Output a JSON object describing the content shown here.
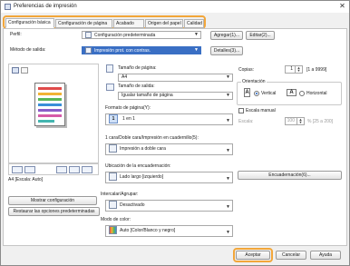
{
  "window": {
    "title": "Preferencias de impresión",
    "close_glyph": "✕"
  },
  "tabs": [
    {
      "label": "Configuración básica",
      "active": true
    },
    {
      "label": "Configuración de página",
      "active": false
    },
    {
      "label": "Acabado",
      "active": false
    },
    {
      "label": "Origen del papel",
      "active": false
    },
    {
      "label": "Calidad",
      "active": false
    }
  ],
  "profile": {
    "label": "Perfil:",
    "value": "Configuración predeterminada",
    "add_label": "Agregar(1)...",
    "edit_label": "Editar(2)..."
  },
  "output_method": {
    "label": "Método de salida:",
    "value": "Impresión prot. con contras.",
    "details_label": "Detalles(3)..."
  },
  "preview": {
    "caption": "A4 [Escala: Auto]"
  },
  "page_size": {
    "label": "Tamaño de página:",
    "value": "A4"
  },
  "output_size": {
    "label": "Tamaño de salida:",
    "value": "Igualar tamaño de página"
  },
  "copies": {
    "label": "Copias:",
    "value": "1",
    "range": "[1 a 9999]"
  },
  "orientation": {
    "label": "Orientación",
    "options": [
      "Vertical",
      "Horizontal"
    ],
    "selected": "Vertical"
  },
  "page_layout": {
    "label": "Formato de página(Y):",
    "value": "1 en 1",
    "icon_number": "1"
  },
  "manual_scaling": {
    "label": "Escala manual",
    "checked": false,
    "scale_label": "Escala:",
    "value": "100",
    "range": "% [25 a 200]"
  },
  "duplex": {
    "label": "1 cara/Doble cara/Impresión en cuadernillo(5):",
    "value": "Impresión a doble cara"
  },
  "binding": {
    "label": "Ubicación de la encuadernación:",
    "value": "Lado largo [izquierdo]",
    "button_label": "Encuadernación(6)..."
  },
  "collate": {
    "label": "Intercalar/Agrupar:",
    "value": "Desactivado"
  },
  "color_mode": {
    "label": "Modo de color:",
    "value": "Auto [Color/Blanco y negro]"
  },
  "left_buttons": {
    "show_settings": "Mostrar configuración",
    "restore_defaults": "Restaurar las opciones predeterminadas"
  },
  "footer": {
    "ok": "Aceptar",
    "cancel": "Cancelar",
    "help": "Ayuda"
  },
  "colors": {
    "highlight": "#f2a63a",
    "selected_blue": "#3a6fc4"
  }
}
